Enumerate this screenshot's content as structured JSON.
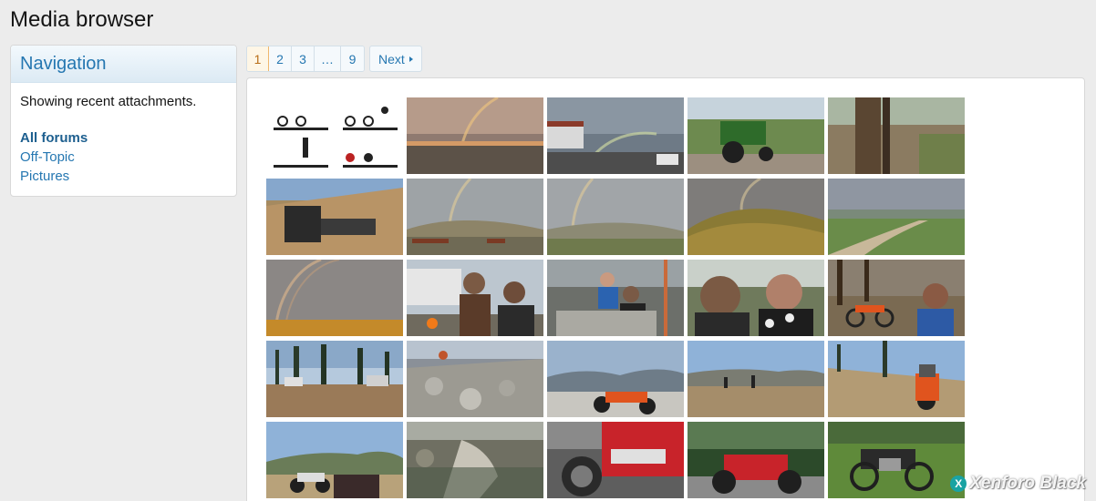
{
  "page": {
    "title": "Media browser"
  },
  "sidebar": {
    "heading": "Navigation",
    "note": "Showing recent attachments.",
    "links": [
      {
        "label": "All forums",
        "active": true
      },
      {
        "label": "Off-Topic",
        "active": false
      },
      {
        "label": "Pictures",
        "active": false
      }
    ]
  },
  "pagination": {
    "pages": [
      "1",
      "2",
      "3",
      "…",
      "9"
    ],
    "current": "1",
    "next_label": "Next"
  },
  "thumbnails": [
    {
      "subject": "motorcycle-riding-positions-chart"
    },
    {
      "subject": "rainbow-over-parking-lot-sunset"
    },
    {
      "subject": "rainbow-over-street"
    },
    {
      "subject": "green-tractor-on-road"
    },
    {
      "subject": "wooden-post-closeup"
    },
    {
      "subject": "tractor-mower-on-hillside"
    },
    {
      "subject": "rainbow-over-pasture-cattle"
    },
    {
      "subject": "rainbow-over-field"
    },
    {
      "subject": "rainbow-over-hill"
    },
    {
      "subject": "cloudy-sky-dirt-road"
    },
    {
      "subject": "double-rainbow-sky"
    },
    {
      "subject": "selfie-two-men-by-trailer"
    },
    {
      "subject": "people-at-campsite-table"
    },
    {
      "subject": "selfie-two-men-in-forest"
    },
    {
      "subject": "dirt-bike-selfie-in-forest"
    },
    {
      "subject": "campground-with-tents"
    },
    {
      "subject": "rider-on-rocky-hill"
    },
    {
      "subject": "dirt-bikes-mountain-view"
    },
    {
      "subject": "bikes-on-mountain-plateau"
    },
    {
      "subject": "dirt-bike-on-trail"
    },
    {
      "subject": "adventure-bikes-mountain"
    },
    {
      "subject": "rocky-creek"
    },
    {
      "subject": "red-sport-motorcycle-closeup"
    },
    {
      "subject": "red-sport-motorcycle-parked"
    },
    {
      "subject": "black-scrambler-on-grass"
    }
  ],
  "watermark": {
    "text": "Xenforo Black",
    "badge": "X"
  }
}
